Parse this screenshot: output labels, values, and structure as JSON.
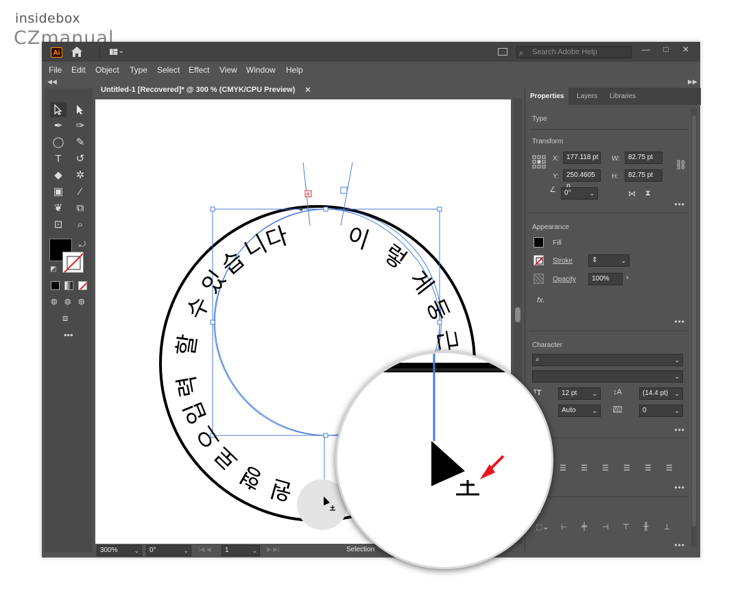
{
  "watermark": {
    "top": "insidebox",
    "bottom": "CZmanual"
  },
  "app": {
    "logo": "Ai",
    "search_placeholder": "Search Adobe Help",
    "window_controls": [
      "—",
      "□",
      "✕"
    ]
  },
  "menu": [
    "File",
    "Edit",
    "Object",
    "Type",
    "Select",
    "Effect",
    "View",
    "Window",
    "Help"
  ],
  "document": {
    "tab_title": "Untitled-1 [Recovered]* @ 300 % (CMYK/CPU Preview)",
    "tab_close": "✕"
  },
  "circle_text": "이렇게 둥근 원형으로 입력할 수 있습니다.",
  "text_path_chars": [
    "다",
    "니",
    "습",
    "있",
    "수",
    "할",
    "력",
    "입",
    "으",
    "로",
    "형",
    "원",
    "근",
    "둥",
    "게",
    "렇",
    "이"
  ],
  "status": {
    "zoom": "300%",
    "rotate": "0°",
    "artboard": "1",
    "tool": "Selection"
  },
  "panel": {
    "tabs": [
      "Properties",
      "Layers",
      "Libraries"
    ],
    "type_label": "Type",
    "transform": {
      "label": "Transform",
      "x_label": "X:",
      "x": "177.118 pt",
      "y_label": "Y:",
      "y": "250.4605 p",
      "w_label": "W:",
      "w": "82.75 pt",
      "h_label": "H:",
      "h": "82.75 pt",
      "angle": "0°"
    },
    "appearance": {
      "label": "Appearance",
      "fill": "Fill",
      "stroke": "Stroke",
      "opacity_label": "Opacity",
      "opacity": "100%",
      "fx": "fx."
    },
    "character": {
      "label": "Character",
      "font_size": "12 pt",
      "leading": "(14.4 pt)",
      "kerning": "Auto",
      "tracking": "0"
    },
    "paragraph_label": "aph",
    "align_label": "ign"
  },
  "colors": {
    "ui_bg": "#535353",
    "ui_dark": "#424242",
    "selection_blue": "#4a7bdc",
    "anchor_red": "#e0202a",
    "arrow_red": "#e8171f"
  }
}
